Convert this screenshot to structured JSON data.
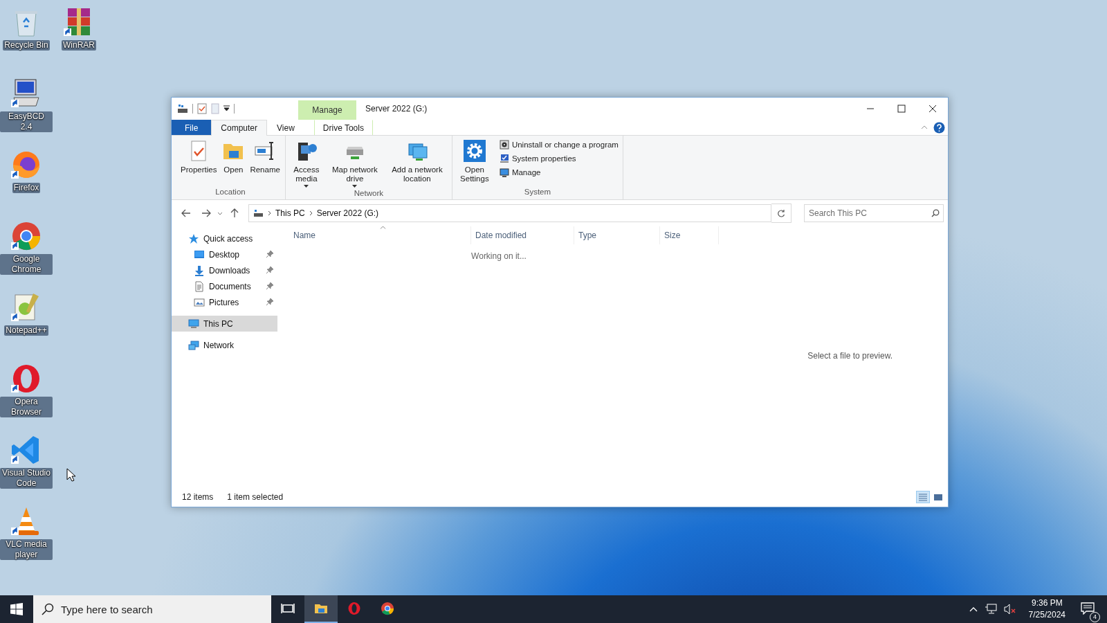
{
  "desktop_icons": [
    {
      "label": "Recycle Bin",
      "kind": "recycle",
      "shortcut": false
    },
    {
      "label": "WinRAR",
      "kind": "winrar",
      "shortcut": true
    },
    {
      "label": "EasyBCD 2.4",
      "kind": "easybcd",
      "shortcut": true
    },
    {
      "label": "Firefox",
      "kind": "firefox",
      "shortcut": true
    },
    {
      "label": "Google Chrome",
      "kind": "chrome",
      "shortcut": true
    },
    {
      "label": "Notepad++",
      "kind": "notepad",
      "shortcut": true
    },
    {
      "label": "Opera Browser",
      "kind": "opera",
      "shortcut": true
    },
    {
      "label": "Visual Studio Code",
      "kind": "vscode",
      "shortcut": true
    },
    {
      "label": "VLC media player",
      "kind": "vlc",
      "shortcut": true
    }
  ],
  "window": {
    "contextual_tab": "Manage",
    "title": "Server 2022 (G:)",
    "tabs": [
      {
        "label": "File",
        "kind": "file",
        "selected": false
      },
      {
        "label": "Computer",
        "kind": "tab",
        "selected": true
      },
      {
        "label": "View",
        "kind": "tab",
        "selected": false
      },
      {
        "label": "Drive Tools",
        "kind": "contextual",
        "selected": false
      }
    ],
    "ribbon_groups": [
      {
        "label": "Location",
        "buttons": [
          {
            "label": "Properties",
            "dropdown": false
          },
          {
            "label": "Open",
            "dropdown": false
          },
          {
            "label": "Rename",
            "dropdown": false
          }
        ]
      },
      {
        "label": "Network",
        "buttons": [
          {
            "label": "Access media",
            "dropdown": true
          },
          {
            "label": "Map network drive",
            "dropdown": true
          },
          {
            "label": "Add a network location",
            "dropdown": false
          }
        ]
      },
      {
        "label": "System",
        "buttons": [
          {
            "label": "Open Settings",
            "dropdown": false
          }
        ],
        "small_buttons": [
          {
            "label": "Uninstall or change a program"
          },
          {
            "label": "System properties"
          },
          {
            "label": "Manage"
          }
        ]
      }
    ],
    "address": {
      "crumbs": [
        "This PC",
        "Server 2022 (G:)"
      ]
    },
    "search": {
      "placeholder": "Search This PC"
    },
    "nav": [
      {
        "label": "Quick access",
        "selected": false,
        "children": [
          {
            "label": "Desktop",
            "pinned": true,
            "selected": false
          },
          {
            "label": "Downloads",
            "pinned": true,
            "selected": false
          },
          {
            "label": "Documents",
            "pinned": true,
            "selected": false
          },
          {
            "label": "Pictures",
            "pinned": true,
            "selected": false
          }
        ]
      },
      {
        "label": "This PC",
        "selected": true
      },
      {
        "label": "Network",
        "selected": false
      }
    ],
    "columns": [
      {
        "label": "Name",
        "sorted": true
      },
      {
        "label": "Date modified",
        "sorted": false
      },
      {
        "label": "Type",
        "sorted": false
      },
      {
        "label": "Size",
        "sorted": false
      }
    ],
    "loading_text": "Working on it...",
    "preview_text": "Select a file to preview.",
    "status_bar": {
      "item_count": "12 items",
      "selection": "1 item selected",
      "views": [
        {
          "kind": "details",
          "selected": true
        },
        {
          "kind": "tiles",
          "selected": false
        }
      ]
    }
  },
  "taskbar": {
    "search": {
      "placeholder": "Type here to search"
    },
    "apps": [
      {
        "kind": "taskview",
        "selected": false
      },
      {
        "kind": "explorer",
        "selected": true
      },
      {
        "kind": "opera",
        "selected": false
      },
      {
        "kind": "chrome",
        "selected": false
      }
    ],
    "time": "9:36 PM",
    "date": "7/25/2024",
    "notifications": "4"
  }
}
